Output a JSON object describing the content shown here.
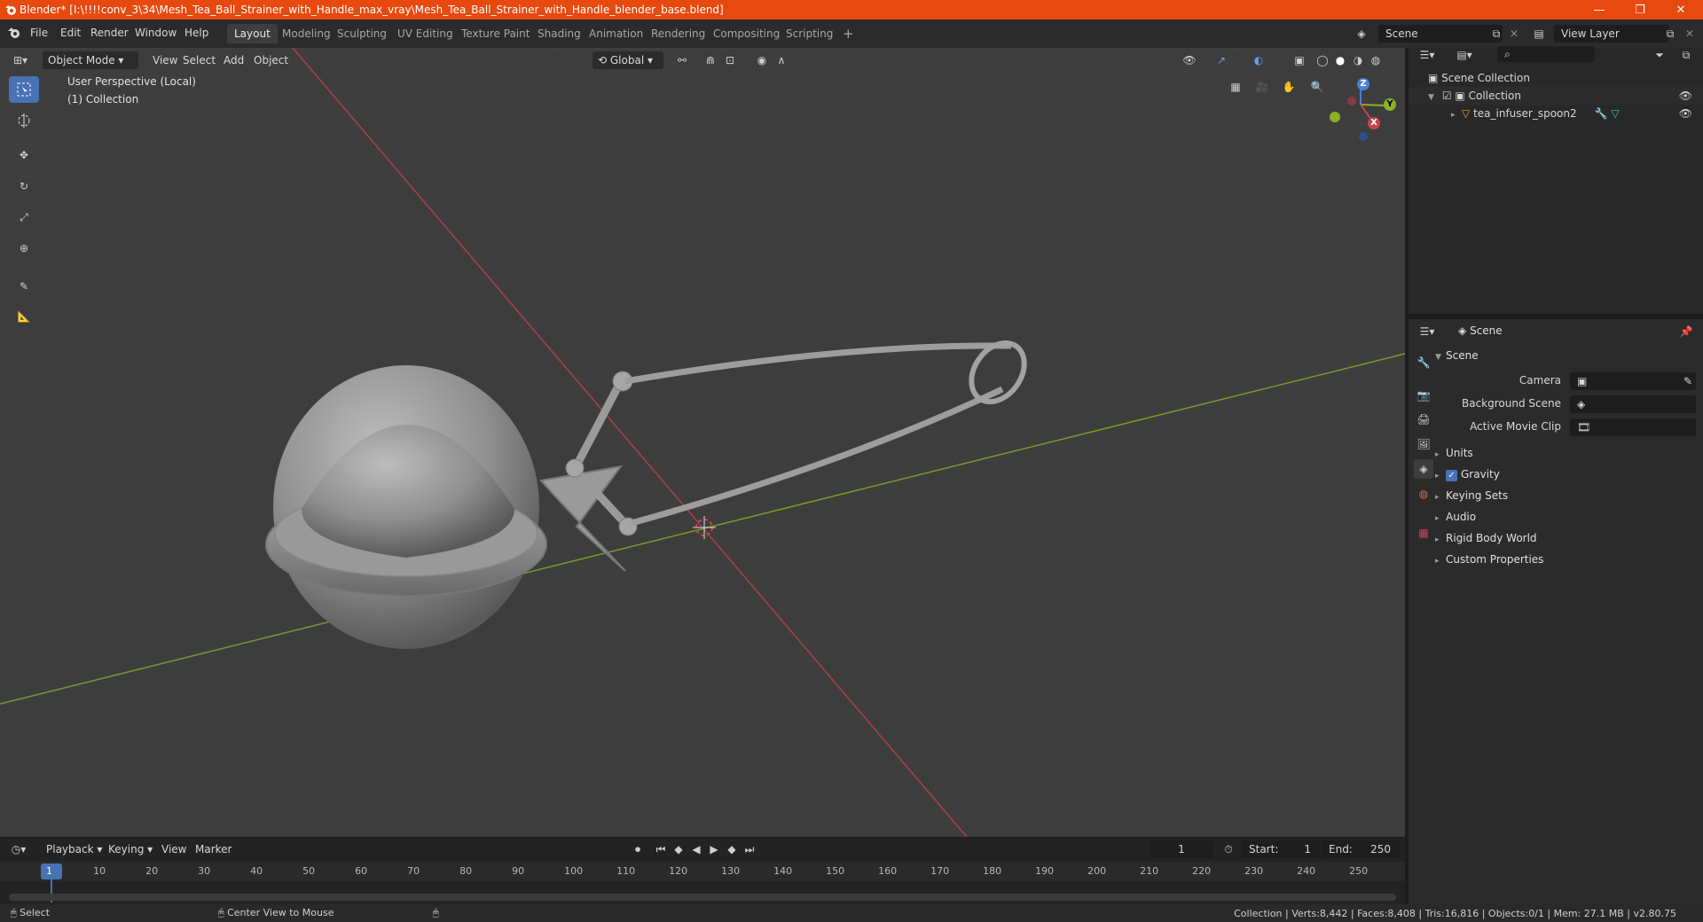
{
  "window": {
    "title": "Blender* [I:\\!!!!conv_3\\34\\Mesh_Tea_Ball_Strainer_with_Handle_max_vray\\Mesh_Tea_Ball_Strainer_with_Handle_blender_base.blend]",
    "minimize": "—",
    "restore": "❐",
    "close": "✕"
  },
  "menu": {
    "items": [
      "File",
      "Edit",
      "Render",
      "Window",
      "Help"
    ],
    "workspaces": [
      "Layout",
      "Modeling",
      "Sculpting",
      "UV Editing",
      "Texture Paint",
      "Shading",
      "Animation",
      "Rendering",
      "Compositing",
      "Scripting"
    ],
    "add_tab": "+",
    "scene": "Scene",
    "view_layer": "View Layer"
  },
  "viewport_header": {
    "mode": "Object Mode",
    "menus": [
      "View",
      "Select",
      "Add",
      "Object"
    ],
    "orientation": "Global"
  },
  "viewport": {
    "perspective": "User Perspective (Local)",
    "collection": "(1) Collection",
    "gizmo_axes": {
      "z": "Z",
      "y": "Y",
      "x": "X"
    }
  },
  "outliner": {
    "search_placeholder": "",
    "scene_collection": "Scene Collection",
    "collection": "Collection",
    "object": "tea_infuser_spoon2"
  },
  "properties": {
    "header": "Scene",
    "panel": "Scene",
    "camera_label": "Camera",
    "background_label": "Background Scene",
    "movie_clip_label": "Active Movie Clip",
    "sections": [
      "Units",
      "Gravity",
      "Keying Sets",
      "Audio",
      "Rigid Body World",
      "Custom Properties"
    ],
    "gravity_checked": true
  },
  "timeline": {
    "menus": [
      "Playback",
      "Keying",
      "View",
      "Marker"
    ],
    "current_frame": "1",
    "start_label": "Start:",
    "start": "1",
    "end_label": "End:",
    "end": "250",
    "ticks": [
      "1",
      "10",
      "20",
      "30",
      "40",
      "50",
      "60",
      "70",
      "80",
      "90",
      "100",
      "110",
      "120",
      "130",
      "140",
      "150",
      "160",
      "170",
      "180",
      "190",
      "200",
      "210",
      "220",
      "230",
      "240",
      "250"
    ]
  },
  "status": {
    "select": "Select",
    "center": "Center View to Mouse",
    "stats": "Collection | Verts:8,442 | Faces:8,408 | Tris:16,816 | Objects:0/1 | Mem: 27.1 MB | v2.80.75"
  },
  "colors": {
    "title_bar": "#e8490f",
    "active_tool": "#4772b3",
    "x_axis": "#c6454b",
    "y_axis": "#8cb028",
    "z_axis": "#4a7fd6"
  }
}
